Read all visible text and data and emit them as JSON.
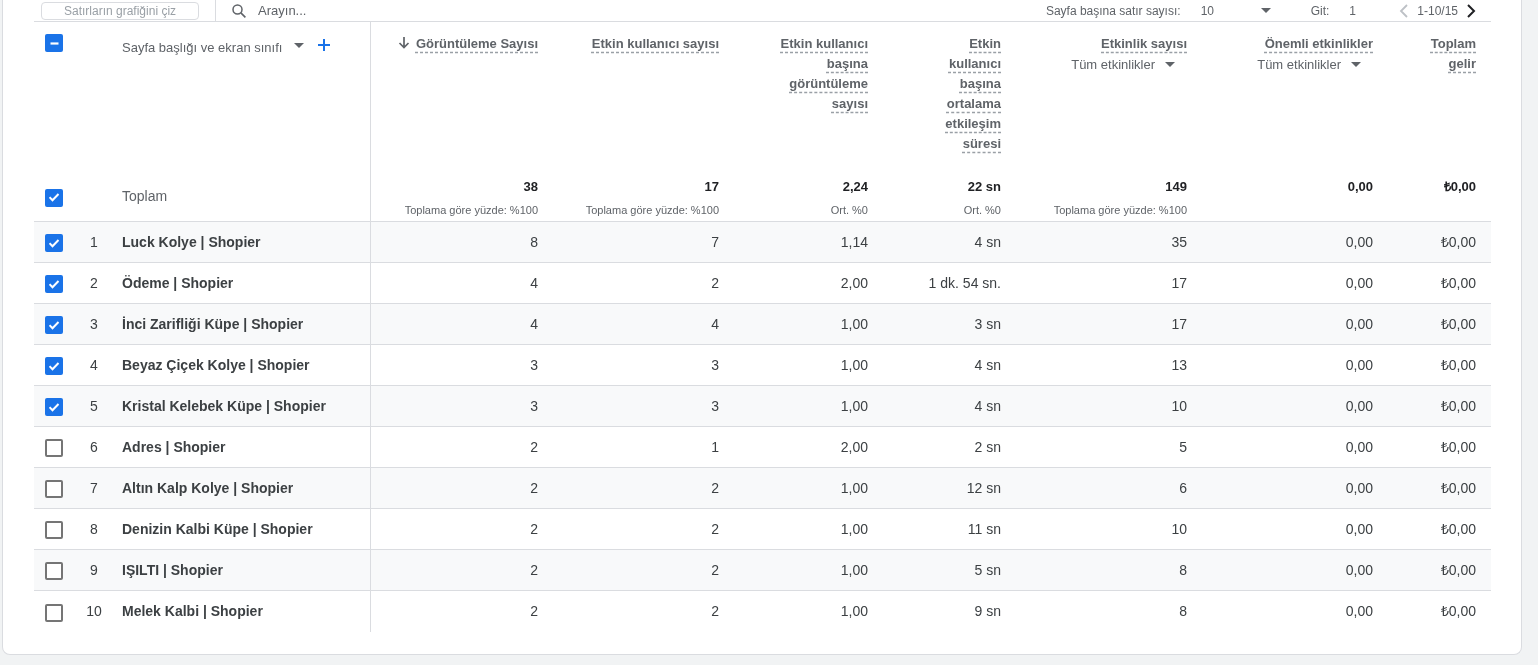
{
  "toolbar": {
    "chart_button": "Satırların grafiğini çiz",
    "search_placeholder": "Arayın...",
    "rows_per_page_label": "Sayfa başına satır sayısı:",
    "rows_per_page_value": "10",
    "goto_label": "Git:",
    "goto_value": "1",
    "range": "1-10/15"
  },
  "table": {
    "select_all": {
      "indeterminate": true
    },
    "dimension_label": "Sayfa başlığı ve ekran sınıfı",
    "columns": [
      {
        "label": "Görüntüleme Sayısı",
        "sorted": true
      },
      {
        "label": "Etkin kullanıcı sayısı",
        "sorted": false
      },
      {
        "label": "Etkin kullanıcı başına görüntüleme sayısı",
        "sorted": false
      },
      {
        "label": "Etkin kullanıcı başına ortalama etkileşim süresi",
        "sorted": false
      },
      {
        "label": "Etkinlik sayısı",
        "sorted": false,
        "filter": "Tüm etkinlikler"
      },
      {
        "label": "Önemli etkinlikler",
        "sorted": false,
        "filter": "Tüm etkinlikler"
      },
      {
        "label": "Toplam gelir",
        "sorted": false
      }
    ],
    "totals": {
      "label": "Toplam",
      "checked": true,
      "values": [
        {
          "value": "38",
          "note": "Toplama göre yüzde: %100"
        },
        {
          "value": "17",
          "note": "Toplama göre yüzde: %100"
        },
        {
          "value": "2,24",
          "note": "Ort. %0"
        },
        {
          "value": "22 sn",
          "note": "Ort. %0"
        },
        {
          "value": "149",
          "note": "Toplama göre yüzde: %100"
        },
        {
          "value": "0,00"
        },
        {
          "value": "₺0,00"
        }
      ]
    },
    "rows": [
      {
        "index": "1",
        "name": "Luck Kolye | Shopier",
        "checked": true,
        "values": [
          "8",
          "7",
          "1,14",
          "4 sn",
          "35",
          "0,00",
          "₺0,00"
        ]
      },
      {
        "index": "2",
        "name": "Ödeme | Shopier",
        "checked": true,
        "values": [
          "4",
          "2",
          "2,00",
          "1 dk. 54 sn.",
          "17",
          "0,00",
          "₺0,00"
        ]
      },
      {
        "index": "3",
        "name": "İnci Zarifliği Küpe | Shopier",
        "checked": true,
        "values": [
          "4",
          "4",
          "1,00",
          "3 sn",
          "17",
          "0,00",
          "₺0,00"
        ]
      },
      {
        "index": "4",
        "name": "Beyaz Çiçek Kolye | Shopier",
        "checked": true,
        "values": [
          "3",
          "3",
          "1,00",
          "4 sn",
          "13",
          "0,00",
          "₺0,00"
        ]
      },
      {
        "index": "5",
        "name": "Kristal Kelebek Küpe | Shopier",
        "checked": true,
        "values": [
          "3",
          "3",
          "1,00",
          "4 sn",
          "10",
          "0,00",
          "₺0,00"
        ]
      },
      {
        "index": "6",
        "name": "Adres | Shopier",
        "checked": false,
        "values": [
          "2",
          "1",
          "2,00",
          "2 sn",
          "5",
          "0,00",
          "₺0,00"
        ]
      },
      {
        "index": "7",
        "name": "Altın Kalp Kolye | Shopier",
        "checked": false,
        "values": [
          "2",
          "2",
          "1,00",
          "12 sn",
          "6",
          "0,00",
          "₺0,00"
        ]
      },
      {
        "index": "8",
        "name": "Denizin Kalbi Küpe | Shopier",
        "checked": false,
        "values": [
          "2",
          "2",
          "1,00",
          "11 sn",
          "10",
          "0,00",
          "₺0,00"
        ]
      },
      {
        "index": "9",
        "name": "IŞILTI | Shopier",
        "checked": false,
        "values": [
          "2",
          "2",
          "1,00",
          "5 sn",
          "8",
          "0,00",
          "₺0,00"
        ]
      },
      {
        "index": "10",
        "name": "Melek Kalbi | Shopier",
        "checked": false,
        "values": [
          "2",
          "2",
          "1,00",
          "9 sn",
          "8",
          "0,00",
          "₺0,00"
        ]
      }
    ]
  }
}
